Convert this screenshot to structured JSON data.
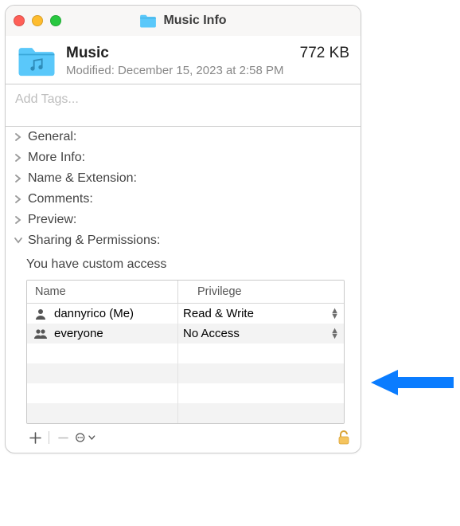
{
  "window": {
    "title": "Music Info"
  },
  "header": {
    "name": "Music",
    "size": "772 KB",
    "modified": "Modified: December 15, 2023 at 2:58 PM"
  },
  "tags": {
    "placeholder": "Add Tags..."
  },
  "sections": {
    "general": "General:",
    "more_info": "More Info:",
    "name_ext": "Name & Extension:",
    "comments": "Comments:",
    "preview": "Preview:",
    "sharing": "Sharing & Permissions:"
  },
  "permissions": {
    "access_note": "You have custom access",
    "col_name": "Name",
    "col_priv": "Privilege",
    "rows": [
      {
        "name": "dannyrico (Me)",
        "priv": "Read & Write",
        "icon": "single"
      },
      {
        "name": "everyone",
        "priv": "No Access",
        "icon": "group"
      }
    ]
  }
}
